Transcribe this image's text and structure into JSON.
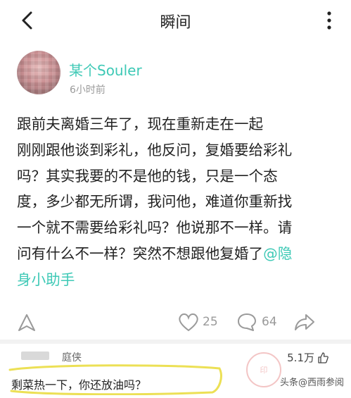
{
  "header": {
    "title": "瞬间",
    "back_icon": "chevron-left-icon",
    "more_icon": "more-vertical-icon"
  },
  "post": {
    "username": "某个Souler",
    "time": "6小时前",
    "text_lines": [
      "跟前夫离婚三年了，现在重新走在一起",
      "刚刚跟他谈到彩礼，他反问，复婚要给彩礼",
      "吗？其实我要的不是他的钱，只是一个态",
      "度，多少都无所谓，我问他，难道你重新找",
      "一个就不需要给彩礼吗？他说那不一样。请",
      "问有什么不一样？突然不想跟他复婚了"
    ],
    "mention_part1": "@隐",
    "mention_part2": "身小助手"
  },
  "actions": {
    "like_count": "25",
    "comment_count": "64"
  },
  "comment": {
    "author": "庭侠",
    "likes": "5.1万",
    "text": "剩菜热一下，你还放油吗？"
  },
  "watermark": "头条@西雨参阅",
  "colors": {
    "accent": "#3ec9b6",
    "muted": "#9a9a9a",
    "highlight": "#f0e060"
  }
}
